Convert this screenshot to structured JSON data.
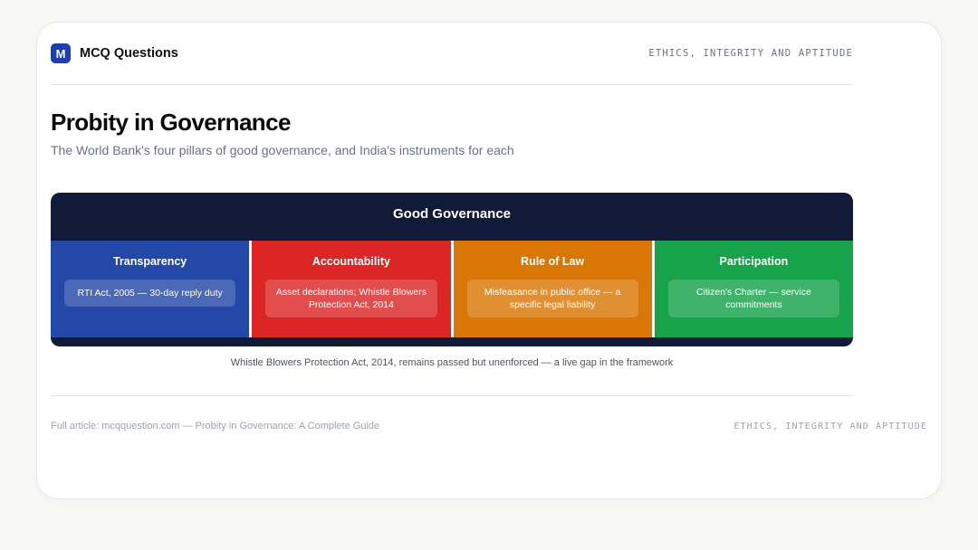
{
  "brand": {
    "logo_letter": "M",
    "name": "MCQ Questions",
    "logo_color": "#1e40af"
  },
  "section_label": "ETHICS, INTEGRITY AND APTITUDE",
  "title": "Probity in Governance",
  "subtitle": "The World Bank's four pillars of good governance, and India's instruments for each",
  "diagram": {
    "title": "Good Governance",
    "header_color": "#111a38",
    "pillars": [
      {
        "name": "Transparency",
        "instrument": "RTI Act, 2005 — 30-day reply duty",
        "color": "#2448a8"
      },
      {
        "name": "Accountability",
        "instrument": "Asset declarations; Whistle Blowers Protection Act, 2014",
        "color": "#dc2626"
      },
      {
        "name": "Rule of Law",
        "instrument": "Misfeasance in public office — a specific legal liability",
        "color": "#d97706"
      },
      {
        "name": "Participation",
        "instrument": "Citizen's Charter — service commitments",
        "color": "#16a34a"
      }
    ]
  },
  "caption": "Whistle Blowers Protection Act, 2014, remains passed but unenforced — a live gap in the framework",
  "footer": {
    "article": "Full article: mcqquestion.com — Probity in Governance: A Complete Guide",
    "label": "ETHICS, INTEGRITY AND APTITUDE"
  }
}
